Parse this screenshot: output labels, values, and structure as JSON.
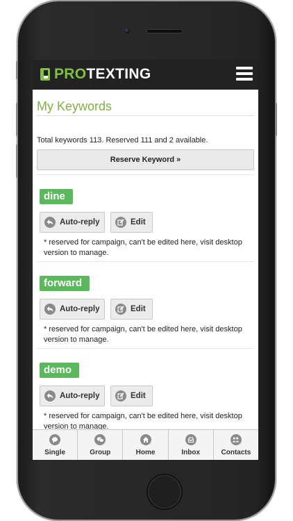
{
  "app": {
    "brand_pro": "PRO",
    "brand_texting": "TEXTING",
    "accent_color": "#7fc241",
    "tag_color": "#5cb85c"
  },
  "page": {
    "title": "My Keywords",
    "totals": "Total keywords 113. Reserved 111 and 2 available.",
    "reserve_label": "Reserve Keyword »"
  },
  "keywords": [
    {
      "name": "dine",
      "autoreply_label": "Auto-reply",
      "edit_label": "Edit",
      "note": "* reserved for campaign, can't be edited here, visit desktop version to manage."
    },
    {
      "name": "forward",
      "autoreply_label": "Auto-reply",
      "edit_label": "Edit",
      "note": "* reserved for campaign, can't be edited here, visit desktop version to manage."
    },
    {
      "name": "demo",
      "autoreply_label": "Auto-reply",
      "edit_label": "Edit",
      "note": "* reserved for campaign, can't be edited here, visit desktop version to manage."
    }
  ],
  "tabs": [
    {
      "label": "Single",
      "icon": "chat-bubble-icon"
    },
    {
      "label": "Group",
      "icon": "group-chat-icon"
    },
    {
      "label": "Home",
      "icon": "home-icon"
    },
    {
      "label": "Inbox",
      "icon": "inbox-icon"
    },
    {
      "label": "Contacts",
      "icon": "contacts-icon"
    }
  ]
}
